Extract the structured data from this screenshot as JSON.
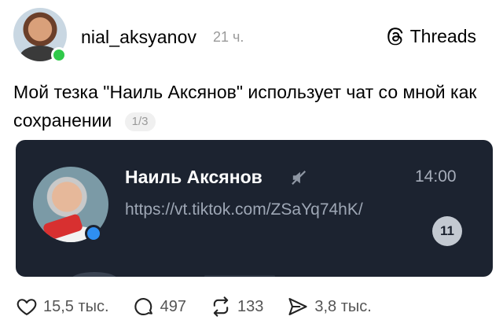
{
  "header": {
    "username": "nial_aksyanov",
    "timestamp": "21 ч.",
    "brand": "Threads",
    "brand_icon": "threads-icon",
    "online_color": "#30c94a"
  },
  "post": {
    "text": "Мой тезка \"Наиль Аксянов\" использует чат со мной как сохранении",
    "page_indicator": "1/3"
  },
  "embedded_chat": {
    "contact_name": "Наиль Аксянов",
    "muted_icon": "mute-icon",
    "time": "14:00",
    "message": "https://vt.tiktok.com/ZSaYq74hK/",
    "unread_count": "11",
    "background_color": "#1c2330"
  },
  "actions": [
    {
      "icon": "heart-icon",
      "count": "15,5 тыс."
    },
    {
      "icon": "comment-icon",
      "count": "497"
    },
    {
      "icon": "repost-icon",
      "count": "133"
    },
    {
      "icon": "share-icon",
      "count": "3,8 тыс."
    }
  ]
}
